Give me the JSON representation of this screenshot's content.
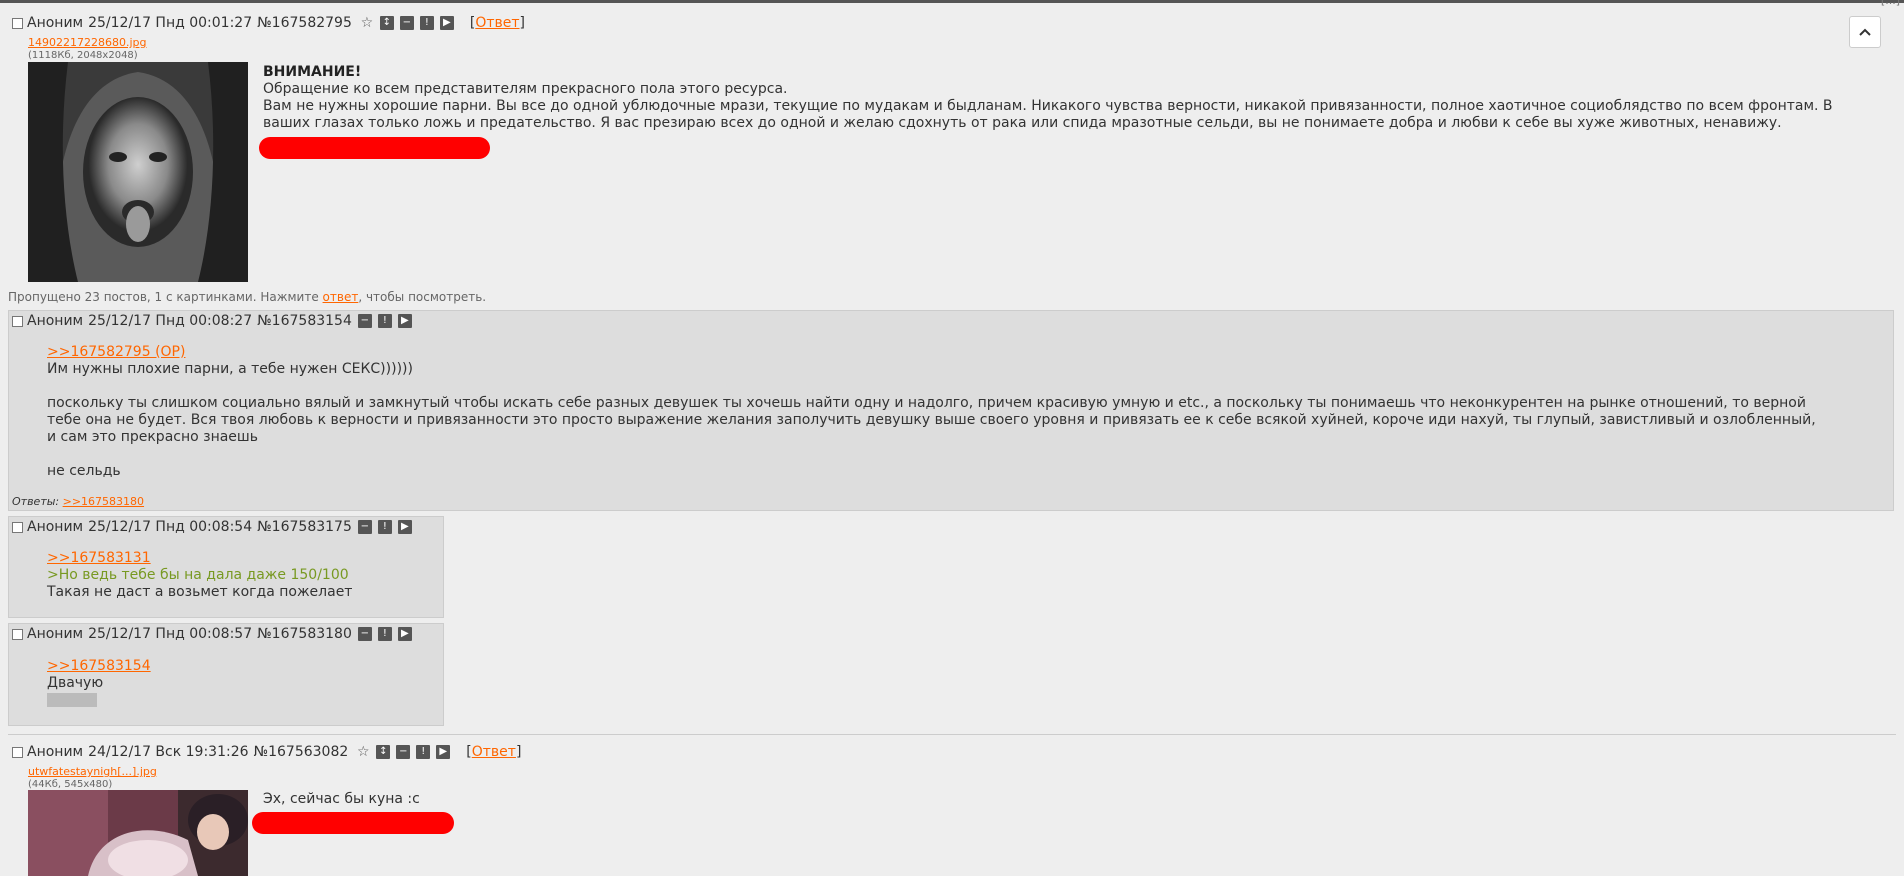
{
  "top_corner": "[...]",
  "thread1": {
    "op": {
      "name": "Аноним",
      "date": "25/12/17 Пнд 00:01:27",
      "num": "№167582795",
      "reply_label": "Ответ",
      "file_name": "14902217228680.jpg",
      "file_meta": "(1118Кб, 2048x2048)",
      "text_title": "ВНИМАНИЕ!",
      "text_lines": [
        "Обращение ко всем представителям прекрасного пола этого ресурса.",
        "Вам не нужны хорошие парни. Вы все до одной ублюдочные мрази, текущие по мудакам и быдланам. Никакого чувства верности, никакой привязанности, полное хаотичное социоблядство по всем фронтам. В",
        "ваших глазах только ложь и предательство. Я вас презираю всех до одной и желаю сдохнуть от рака или спида мразотные сельди, вы не понимаете добра и любви к себе вы хуже животных, ненавижу."
      ]
    },
    "omitted": {
      "before": "Пропущено 23 постов, 1 с картинками. Нажмите ",
      "link": "ответ",
      "after": ", чтобы посмотреть."
    },
    "replies": [
      {
        "name": "Аноним",
        "date": "25/12/17 Пнд 00:08:27",
        "num": "№167583154",
        "quote": ">>167582795 (OP)",
        "lines": [
          "Им нужны плохие парни, а тебе нужен СЕКС))))))",
          "",
          "поскольку ты слишком социально вялый и замкнутый чтобы искать себе разных девушек ты хочешь найти одну и надолго, причем красивую умную и etc., а поскольку ты понимаешь что неконкурентен на рынке отношений, то верной",
          "тебе она не будет. Вся твоя любовь к верности и привязанности это просто выражение желания заполучить девушку выше своего уровня и привязать ее к себе всякой хуйней, короче иди нахуй, ты глупый, завистливый и озлобленный,",
          "и сам это прекрасно знаешь",
          "",
          "не сельдь"
        ],
        "answers_label": "Ответы:",
        "answers_link": ">>167583180"
      },
      {
        "name": "Аноним",
        "date": "25/12/17 Пнд 00:08:54",
        "num": "№167583175",
        "quote": ">>167583131",
        "greentext": ">Но ведь тебе бы на дала даже 150/100",
        "line": "Такая не даст а возьмет когда пожелает"
      },
      {
        "name": "Аноним",
        "date": "25/12/17 Пнд 00:08:57",
        "num": "№167583180",
        "quote": ">>167583154",
        "line": "Двачую"
      }
    ]
  },
  "thread2": {
    "op": {
      "name": "Аноним",
      "date": "24/12/17 Вск 19:31:26",
      "num": "№167563082",
      "reply_label": "Ответ",
      "file_name": "utwfatestaynigh[...].jpg",
      "file_meta": "(44Кб, 545x480)",
      "text": "Эх, сейчас бы куна :с"
    }
  },
  "colors": {
    "background": "#eeeeee",
    "reply_bg": "#dddddd",
    "link": "#ff6600",
    "greentext": "#789922",
    "redaction": "#ff0000"
  },
  "icons": [
    "star-icon",
    "expand-icon",
    "hide-icon",
    "report-icon",
    "play-icon",
    "chevron-up-icon"
  ]
}
